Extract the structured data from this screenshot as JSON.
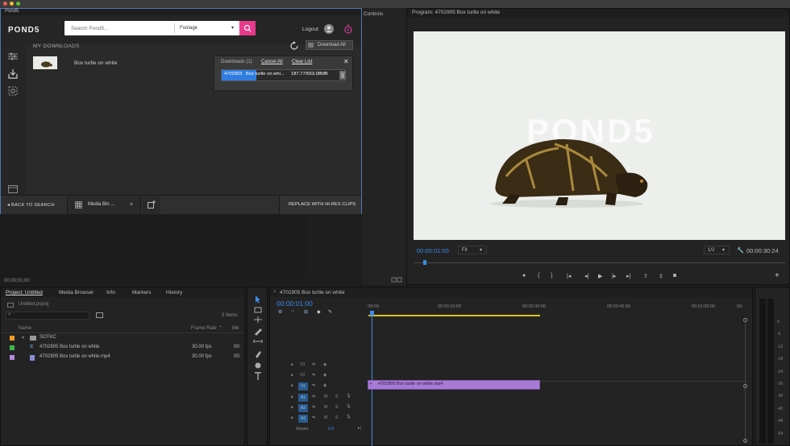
{
  "pond5": {
    "tab": "Pond5",
    "logo": "POND5",
    "search_placeholder": "Search Pond5...",
    "category": "Footage",
    "logout": "Logout",
    "my_downloads": "MY DOWNLOADS",
    "download_all": "Download All",
    "item_title": "Box turtle on white",
    "popup": {
      "title": "Downloads (1)",
      "cancel_all": "Cancel All",
      "clear_list": "Clear List",
      "file_id": "4702905",
      "file_name": "Box turtle on whi...",
      "size": "187.77/653.08MB",
      "progress_fraction": 0.28
    },
    "bottom": {
      "back": "BACK TO SEARCH",
      "media_bin": "Media Bin ...",
      "replace": "REPLACE WITH HI-RES CLIPS"
    }
  },
  "source": {
    "effects_tab": "Controls",
    "timecode": "00;00;01;00"
  },
  "program": {
    "title": "Program: 4702905 Box turtle on white",
    "timecode": "00:00:01:00",
    "fit": "Fit",
    "resolution": "1/2",
    "duration": "00:00:30:24",
    "watermark": "POND5"
  },
  "project": {
    "tabs": [
      "Project: Untitled",
      "Media Browser",
      "Info",
      "Markers",
      "History"
    ],
    "file": "Untitled.prproj",
    "items_count": "3 Items",
    "columns": {
      "name": "Name",
      "frame_rate": "Frame Rate",
      "media": "Me"
    },
    "rows": [
      {
        "name": "SOTKC",
        "rate": "",
        "extra": "",
        "color": "#f29a1f"
      },
      {
        "name": "4702905 Box turtle on white",
        "rate": "30.00 fps",
        "extra": "00:",
        "color": "#3cb94b"
      },
      {
        "name": "4702905 Box turtle on white.mp4",
        "rate": "30.00 fps",
        "extra": "00:",
        "color": "#b48be0"
      }
    ]
  },
  "timeline": {
    "tab": "4702905 Box turtle on white",
    "timecode": "00:00:01:00",
    "ruler": [
      ":00:00",
      "00:00:15:00",
      "00:00:30:00",
      "00:00:45:00",
      "00:01:00:00",
      "00:"
    ],
    "video_tracks": [
      "V3",
      "V2",
      "V1"
    ],
    "audio_tracks": [
      "A1",
      "A2",
      "A3"
    ],
    "master": "Master",
    "master_val": "0.0",
    "clip": "4702905 Box turtle on white.mp4"
  },
  "meters": {
    "scale": [
      "0",
      "-6",
      "-12",
      "-18",
      "-24",
      "-30",
      "-36",
      "-42",
      "-48",
      "-54"
    ]
  },
  "colors": {
    "accent": "#2f7de1",
    "pond5_pink": "#ea3a8d",
    "clip": "#a77ad6"
  }
}
